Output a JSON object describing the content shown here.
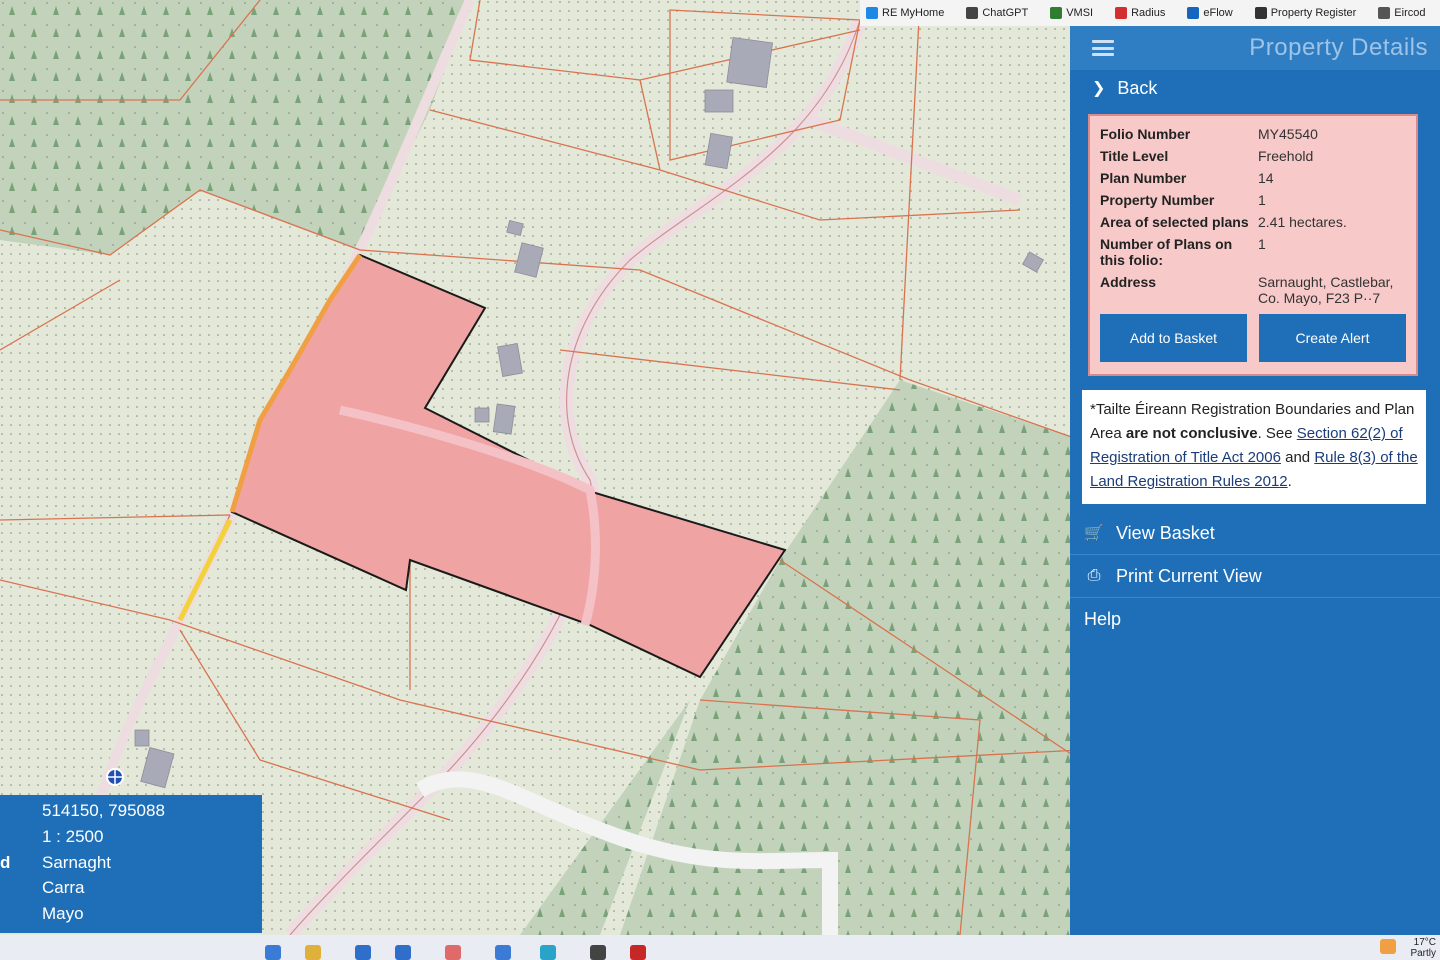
{
  "bookmarks": [
    {
      "label": "RE MyHome",
      "icon": "globe-icon",
      "color": "#1e88e5"
    },
    {
      "label": "ChatGPT",
      "icon": "chatgpt-icon",
      "color": "#444444"
    },
    {
      "label": "VMSI",
      "icon": "document-icon",
      "color": "#2e7d32"
    },
    {
      "label": "Radius",
      "icon": "radius-icon",
      "color": "#d32f2f"
    },
    {
      "label": "eFlow",
      "icon": "eflow-icon",
      "color": "#1565c0"
    },
    {
      "label": "Property Register",
      "icon": "register-icon",
      "color": "#333333"
    },
    {
      "label": "Eircod",
      "icon": "eircode-icon",
      "color": "#555555"
    }
  ],
  "panel": {
    "title": "Property Details",
    "back_label": "Back",
    "details": [
      {
        "label": "Folio Number",
        "value": "MY45540"
      },
      {
        "label": "Title Level",
        "value": "Freehold"
      },
      {
        "label": "Plan Number",
        "value": "14"
      },
      {
        "label": "Property Number",
        "value": "1"
      },
      {
        "label": "Area of selected plans",
        "value": "2.41 hectares."
      },
      {
        "label": "Number of Plans on this folio:",
        "value": "1"
      },
      {
        "label": "Address",
        "value": "Sarnaught, Castlebar, Co. Mayo, F23 P··7"
      }
    ],
    "add_to_basket": "Add to Basket",
    "create_alert": "Create Alert",
    "disclaimer": {
      "prefix": "*Tailte Éireann Registration Boundaries and Plan Area ",
      "bold": "are not conclusive",
      "middle": ". See ",
      "link1": "Section 62(2) of Registration of Title Act 2006",
      "and": " and ",
      "link2": "Rule 8(3) of the Land Registration Rules 2012",
      "end": "."
    },
    "view_basket": "View Basket",
    "print_view": "Print Current View",
    "help": "Help"
  },
  "info": {
    "coords": "514150, 795088",
    "scale": "1 : 2500",
    "cut_label": "d",
    "townland": "Sarnaght",
    "barony": "Carra",
    "county": "Mayo"
  },
  "weather": {
    "temp": "17°C",
    "desc": "Partly"
  },
  "colors": {
    "panel": "#1f6fb8",
    "parcel": "#f0a3a3",
    "boundary": "#d9734f",
    "forest": "#b8ccb0"
  }
}
